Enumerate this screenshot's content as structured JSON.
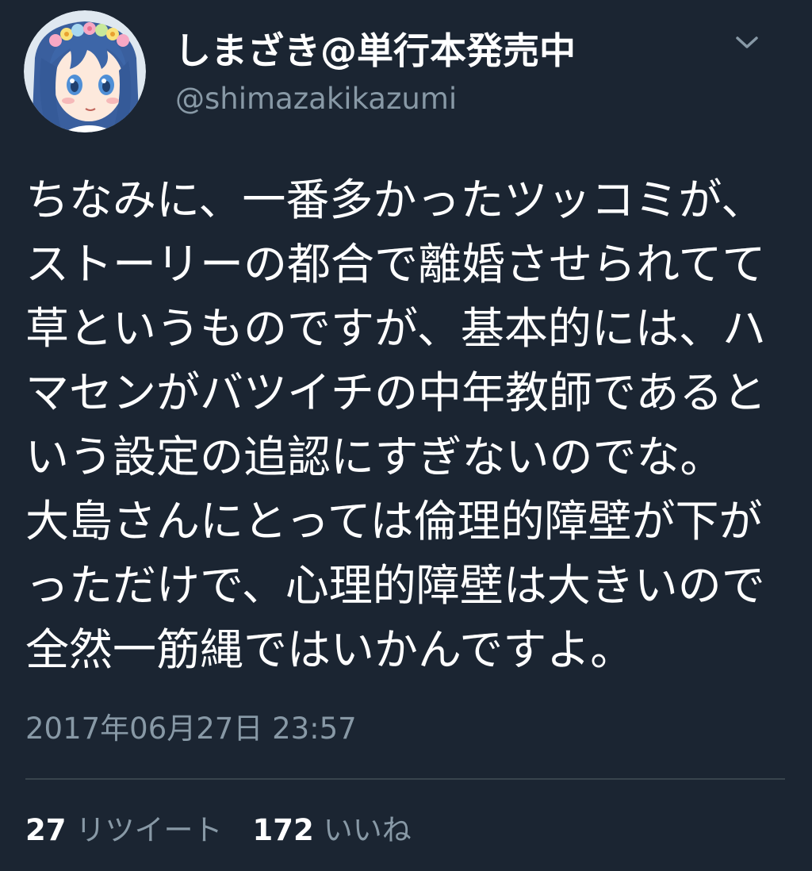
{
  "user": {
    "display_name": "しまざき@単行本発売中",
    "handle": "@shimazakikazumi",
    "avatar_icon": "anime-girl-avatar-icon"
  },
  "tweet": {
    "text": "ちなみに、一番多かったツッコミが、ストーリーの都合で離婚させられてて草というものですが、基本的には、ハマセンがバツイチの中年教師であるという設定の追認にすぎないのでな。\n大島さんにとっては倫理的障壁が下がっただけで、心理的障壁は大きいので全然一筋縄ではいかんですよ。",
    "timestamp": "2017年06月27日 23:57"
  },
  "stats": {
    "retweets_count": "27",
    "retweets_label": "リツイート",
    "likes_count": "172",
    "likes_label": "いいね"
  },
  "colors": {
    "background": "#1b2532",
    "text_primary": "#ffffff",
    "text_secondary": "#8899a6",
    "divider": "#38444d"
  }
}
